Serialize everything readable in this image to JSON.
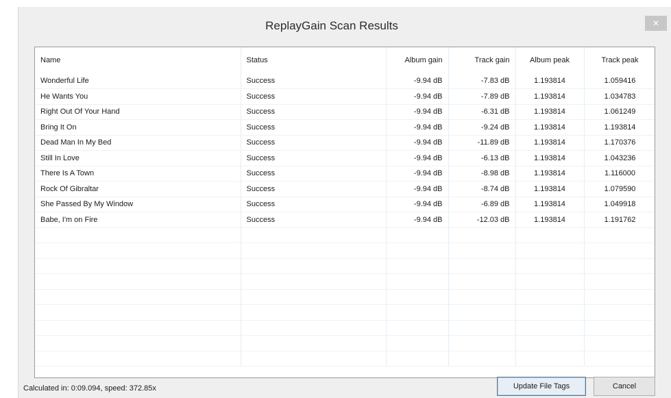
{
  "window": {
    "title": "ReplayGain Scan Results",
    "close_label": "✕"
  },
  "table": {
    "columns": [
      "Name",
      "Status",
      "Album gain",
      "Track gain",
      "Album peak",
      "Track peak"
    ],
    "rows": [
      [
        "Wonderful Life",
        "Success",
        "-9.94 dB",
        "-7.83 dB",
        "1.193814",
        "1.059416"
      ],
      [
        "He Wants You",
        "Success",
        "-9.94 dB",
        "-7.89 dB",
        "1.193814",
        "1.034783"
      ],
      [
        "Right Out Of Your Hand",
        "Success",
        "-9.94 dB",
        "-6.31 dB",
        "1.193814",
        "1.061249"
      ],
      [
        "Bring It On",
        "Success",
        "-9.94 dB",
        "-9.24 dB",
        "1.193814",
        "1.193814"
      ],
      [
        "Dead Man In My Bed",
        "Success",
        "-9.94 dB",
        "-11.89 dB",
        "1.193814",
        "1.170376"
      ],
      [
        "Still In Love",
        "Success",
        "-9.94 dB",
        "-6.13 dB",
        "1.193814",
        "1.043236"
      ],
      [
        "There Is A Town",
        "Success",
        "-9.94 dB",
        "-8.98 dB",
        "1.193814",
        "1.116000"
      ],
      [
        "Rock Of Gibraltar",
        "Success",
        "-9.94 dB",
        "-8.74 dB",
        "1.193814",
        "1.079590"
      ],
      [
        "She Passed By My Window",
        "Success",
        "-9.94 dB",
        "-6.89 dB",
        "1.193814",
        "1.049918"
      ],
      [
        "Babe, I'm on Fire",
        "Success",
        "-9.94 dB",
        "-12.03 dB",
        "1.193814",
        "1.191762"
      ]
    ],
    "empty_rows": 9
  },
  "footer": {
    "status_text": "Calculated in: 0:09.094, speed: 372.85x",
    "update_button": "Update File Tags",
    "cancel_button": "Cancel"
  }
}
